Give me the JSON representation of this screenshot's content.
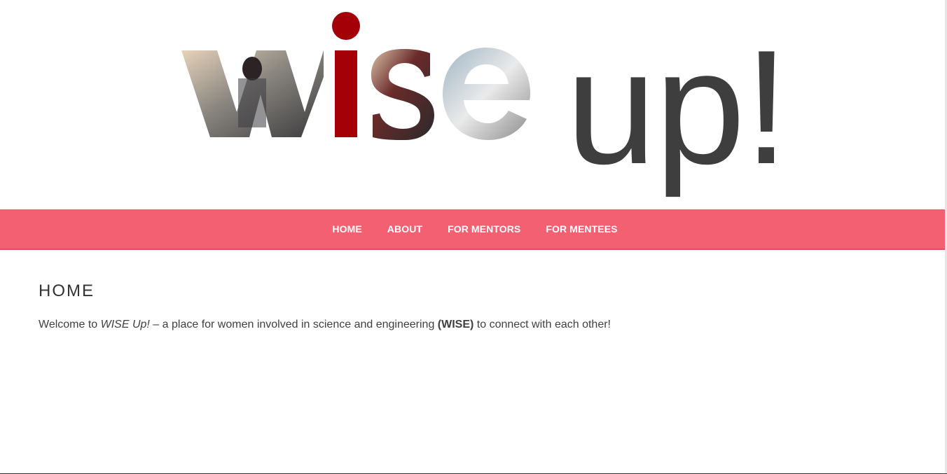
{
  "header": {
    "logo_wordmark": "wise",
    "logo_suffix": "up!"
  },
  "nav": {
    "items": [
      {
        "label": "HOME"
      },
      {
        "label": "ABOUT"
      },
      {
        "label": "FOR MENTORS"
      },
      {
        "label": "FOR MENTEES"
      }
    ]
  },
  "main": {
    "title": "HOME",
    "intro": {
      "prefix": "Welcome to ",
      "site_name": "WISE Up!",
      "middle": " – a place for women involved in science and engineering ",
      "acronym": "(WISE)",
      "suffix": " to connect with each other!"
    }
  },
  "colors": {
    "nav_background": "#f26071",
    "logo_accent": "#a30008",
    "logo_text": "#3e3e3e"
  }
}
